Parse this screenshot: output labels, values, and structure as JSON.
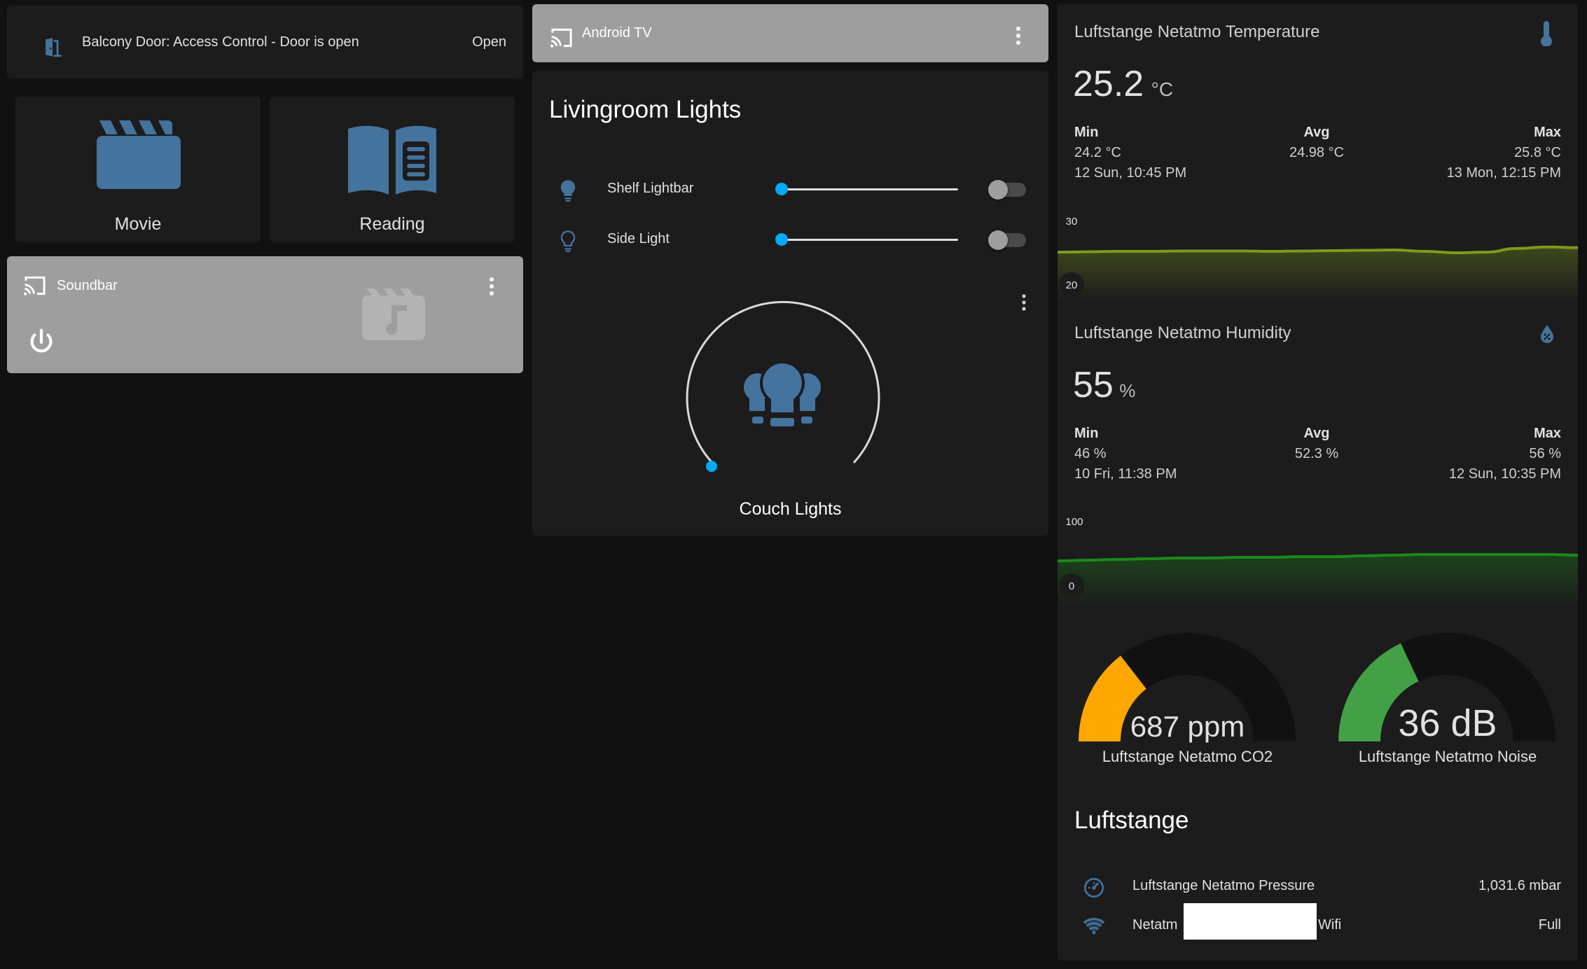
{
  "colors": {
    "background": "#111111",
    "card": "#1c1c1c",
    "card_light": "#9e9e9e",
    "icon_blue": "#44739e",
    "slider_blue": "#03a9f4",
    "co2_orange": "#ffa600",
    "noise_green": "#43a047",
    "temp_line": "#7f9a1c",
    "humidity_line": "#1b8a1b"
  },
  "balcony": {
    "icon": "door-open-icon",
    "label": "Balcony Door: Access Control - Door is open",
    "state": "Open"
  },
  "scenes": [
    {
      "icon": "movie-clapper-icon",
      "label": "Movie"
    },
    {
      "icon": "book-open-icon",
      "label": "Reading"
    }
  ],
  "soundbar": {
    "icon": "cast-icon",
    "name": "Soundbar",
    "menu_icon": "more-vertical-icon",
    "power_icon": "power-icon",
    "art_icon": "music-video-icon"
  },
  "android_tv": {
    "icon": "cast-icon",
    "name": "Android TV",
    "menu_icon": "more-vertical-icon"
  },
  "livingroom": {
    "title": "Livingroom Lights",
    "lights": [
      {
        "icon": "lightbulb-icon",
        "name": "Shelf Lightbar",
        "brightness": 0,
        "on": false
      },
      {
        "icon": "lightbulb-outline-icon",
        "name": "Side Light",
        "brightness": 0,
        "on": false
      }
    ],
    "dimmer": {
      "icon": "lightbulb-group-icon",
      "name": "Couch Lights",
      "level": 0,
      "menu_icon": "more-vertical-icon"
    }
  },
  "temperature": {
    "title": "Luftstange Netatmo Temperature",
    "icon": "thermometer-icon",
    "value": "25.2",
    "unit": "°C",
    "min_label": "Min",
    "min_value": "24.2 °C",
    "min_time": "12 Sun, 10:45 PM",
    "avg_label": "Avg",
    "avg_value": "24.98 °C",
    "max_label": "Max",
    "max_value": "25.8 °C",
    "max_time": "13 Mon, 12:15 PM",
    "axis_max": "30",
    "axis_min": "20",
    "series": [
      24.8,
      24.85,
      24.9,
      24.9,
      24.95,
      24.95,
      24.95,
      24.9,
      24.95,
      25.0,
      25.05,
      25.1,
      24.9,
      24.7,
      24.8,
      25.3,
      25.5,
      25.4
    ]
  },
  "humidity": {
    "title": "Luftstange Netatmo Humidity",
    "icon": "water-percent-icon",
    "value": "55",
    "unit": "%",
    "min_label": "Min",
    "min_value": "46 %",
    "min_time": "10 Fri, 11:38 PM",
    "avg_label": "Avg",
    "avg_value": "52.3 %",
    "max_label": "Max",
    "max_value": "56 %",
    "max_time": "12 Sun, 10:35 PM",
    "axis_max": "100",
    "axis_min": "0",
    "series": [
      46,
      47,
      48,
      49,
      50,
      50,
      51,
      51,
      52,
      52,
      53,
      54,
      55,
      55,
      55,
      55,
      55,
      54
    ]
  },
  "gauges": [
    {
      "value_text": "687 ppm",
      "name": "Luftstange Netatmo CO2",
      "fraction": 0.29
    },
    {
      "value_text": "36 dB",
      "name": "Luftstange Netatmo Noise",
      "fraction": 0.36
    }
  ],
  "luftstange": {
    "title": "Luftstange",
    "rows": [
      {
        "icon": "gauge-icon",
        "name": "Luftstange Netatmo Pressure",
        "value": "1,031.6 mbar"
      },
      {
        "icon": "wifi-icon",
        "name_prefix": "Netatm",
        "name_suffix": "Wifi",
        "value": "Full"
      }
    ]
  }
}
